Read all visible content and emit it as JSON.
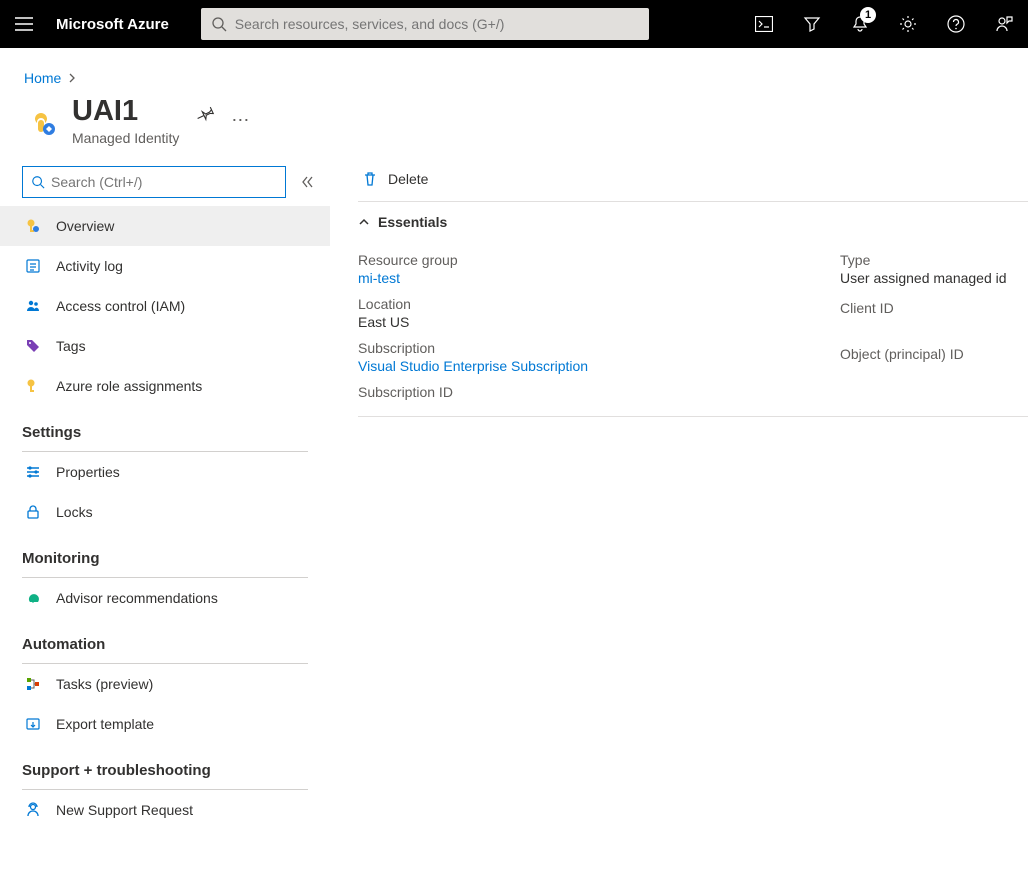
{
  "header": {
    "brand": "Microsoft Azure",
    "search_placeholder": "Search resources, services, and docs (G+/)",
    "notification_badge": "1"
  },
  "breadcrumb": {
    "items": [
      "Home"
    ]
  },
  "resource": {
    "title": "UAI1",
    "subtitle": "Managed Identity"
  },
  "sidebar": {
    "search_placeholder": "Search (Ctrl+/)",
    "top_items": [
      {
        "label": "Overview"
      },
      {
        "label": "Activity log"
      },
      {
        "label": "Access control (IAM)"
      },
      {
        "label": "Tags"
      },
      {
        "label": "Azure role assignments"
      }
    ],
    "sections": [
      {
        "title": "Settings",
        "items": [
          {
            "label": "Properties"
          },
          {
            "label": "Locks"
          }
        ]
      },
      {
        "title": "Monitoring",
        "items": [
          {
            "label": "Advisor recommendations"
          }
        ]
      },
      {
        "title": "Automation",
        "items": [
          {
            "label": "Tasks (preview)"
          },
          {
            "label": "Export template"
          }
        ]
      },
      {
        "title": "Support + troubleshooting",
        "items": [
          {
            "label": "New Support Request"
          }
        ]
      }
    ]
  },
  "commandBar": {
    "delete_label": "Delete"
  },
  "essentials": {
    "header_label": "Essentials",
    "left": [
      {
        "label": "Resource group",
        "value": "mi-test",
        "is_link": true
      },
      {
        "label": "Location",
        "value": "East US",
        "is_link": false
      },
      {
        "label": "Subscription",
        "value": "Visual Studio Enterprise Subscription",
        "is_link": true
      },
      {
        "label": "Subscription ID",
        "value": "",
        "is_link": false
      }
    ],
    "right": [
      {
        "label": "Type",
        "value": "User assigned managed id"
      },
      {
        "label": "Client ID",
        "value": ""
      },
      {
        "label": "Object (principal) ID",
        "value": ""
      }
    ]
  }
}
